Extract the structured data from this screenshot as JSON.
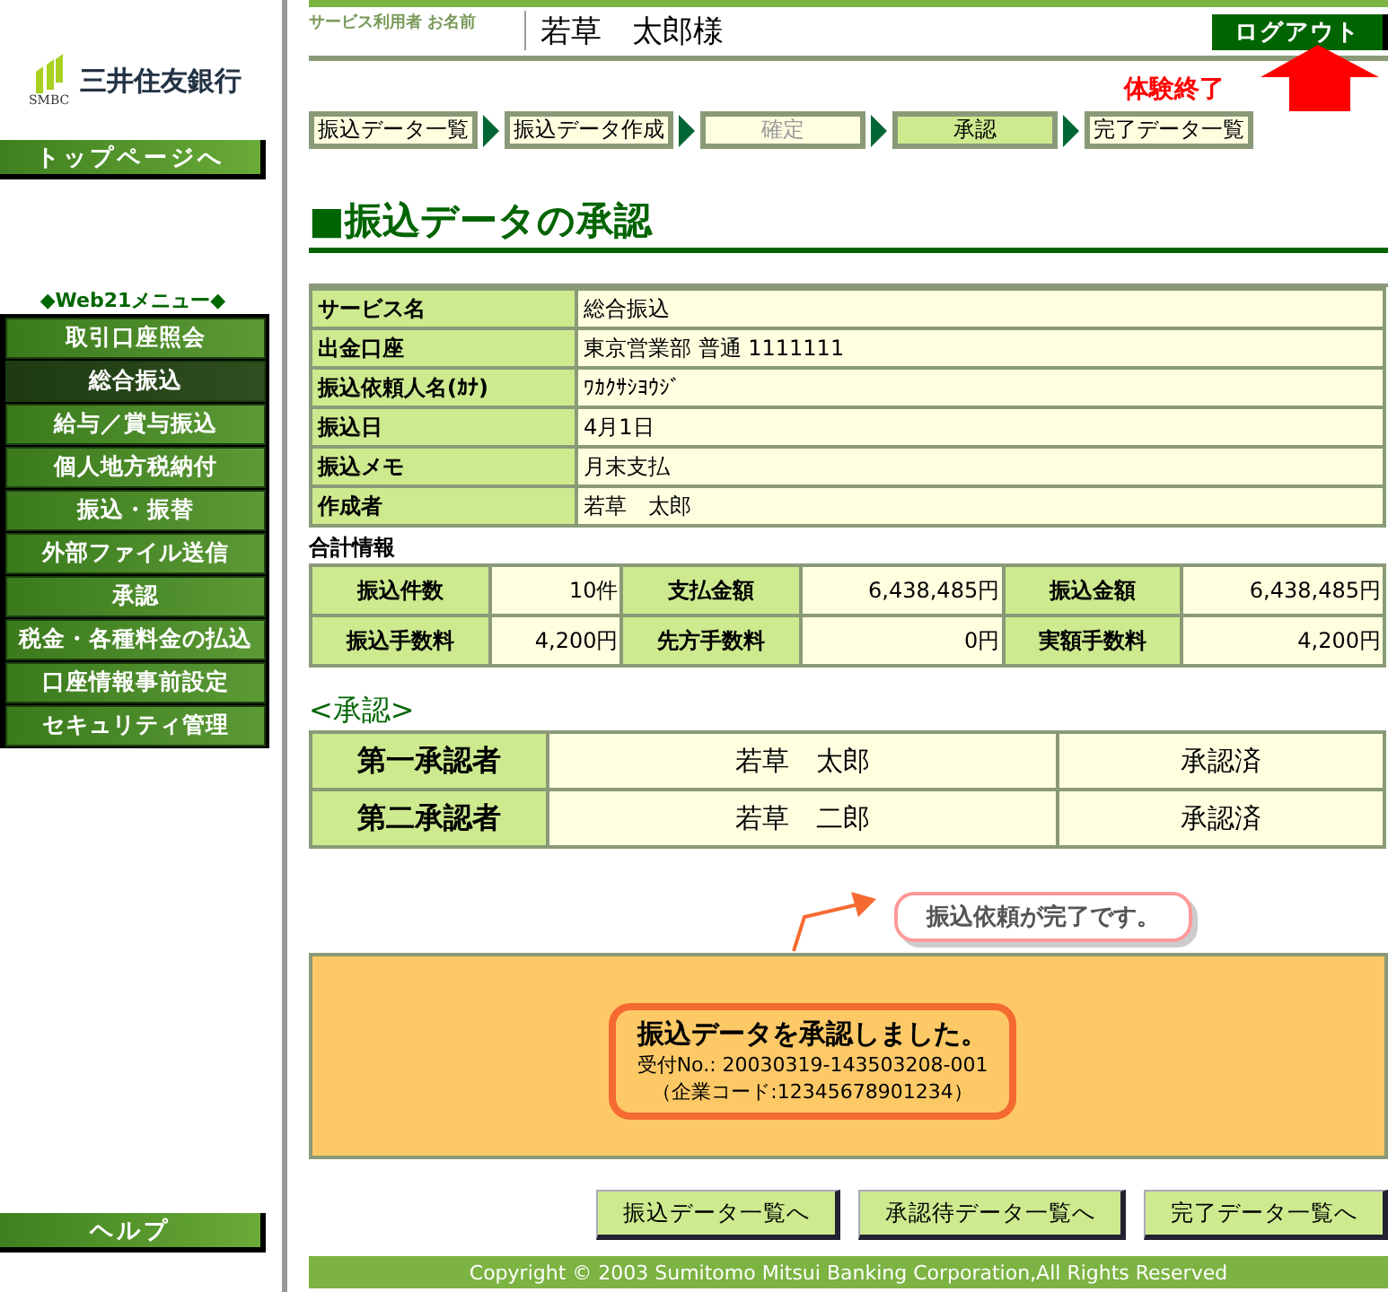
{
  "logo": {
    "name": "三井住友銀行",
    "sub": "SMBC"
  },
  "top_button": "トップページへ",
  "menu": {
    "title": "◆Web21メニュー◆",
    "items": [
      {
        "label": "取引口座照会",
        "selected": false
      },
      {
        "label": "総合振込",
        "selected": true
      },
      {
        "label": "給与／賞与振込",
        "selected": false
      },
      {
        "label": "個人地方税納付",
        "selected": false
      },
      {
        "label": "振込・振替",
        "selected": false
      },
      {
        "label": "外部ファイル送信",
        "selected": false
      },
      {
        "label": "承認",
        "selected": false
      },
      {
        "label": "税金・各種料金の払込",
        "selected": false
      },
      {
        "label": "口座情報事前設定",
        "selected": false
      },
      {
        "label": "セキュリティ管理",
        "selected": false
      }
    ]
  },
  "help_button": "ヘルプ",
  "header": {
    "user_label": "サービス利用者 お名前",
    "user_name": "若草　太郎様",
    "logout": "ログアウト"
  },
  "annotation": "体験終了",
  "steps": [
    {
      "label": "振込データ一覧",
      "selected": false,
      "disabled": false
    },
    {
      "label": "振込データ作成",
      "selected": false,
      "disabled": false
    },
    {
      "label": "確定",
      "selected": false,
      "disabled": true
    },
    {
      "label": "承認",
      "selected": true,
      "disabled": false
    },
    {
      "label": "完了データ一覧",
      "selected": false,
      "disabled": false
    }
  ],
  "page_title": "■振込データの承認",
  "info": [
    {
      "label": "サービス名",
      "value": "総合振込"
    },
    {
      "label": "出金口座",
      "value": "東京営業部 普通 1111111"
    },
    {
      "label": "振込依頼人名(ｶﾅ)",
      "value": "ﾜｶｸｻｼﾖｳｼﾞ"
    },
    {
      "label": "振込日",
      "value": "4月1日"
    },
    {
      "label": "振込メモ",
      "value": "月末支払"
    },
    {
      "label": "作成者",
      "value": "若草　太郎"
    }
  ],
  "totals_title": "合計情報",
  "totals": [
    [
      {
        "label": "振込件数",
        "value": "10件"
      },
      {
        "label": "支払金額",
        "value": "6,438,485円"
      },
      {
        "label": "振込金額",
        "value": "6,438,485円"
      }
    ],
    [
      {
        "label": "振込手数料",
        "value": "4,200円"
      },
      {
        "label": "先方手数料",
        "value": "0円"
      },
      {
        "label": "実額手数料",
        "value": "4,200円"
      }
    ]
  ],
  "approval_title": "<承認>",
  "approvers": [
    {
      "role": "第一承認者",
      "name": "若草　太郎",
      "status": "承認済"
    },
    {
      "role": "第二承認者",
      "name": "若草　二郎",
      "status": "承認済"
    }
  ],
  "callout": "振込依頼が完了です。",
  "result": {
    "message": "振込データを承認しました。",
    "receipt": "受付No.: 20030319-143503208-001",
    "company_code": "（企業コード:12345678901234）"
  },
  "buttons": [
    "振込データ一覧へ",
    "承認待データ一覧へ",
    "完了データ一覧へ"
  ],
  "copyright": "Copyright © 2003 Sumitomo Mitsui Banking Corporation,All Rights Reserved"
}
